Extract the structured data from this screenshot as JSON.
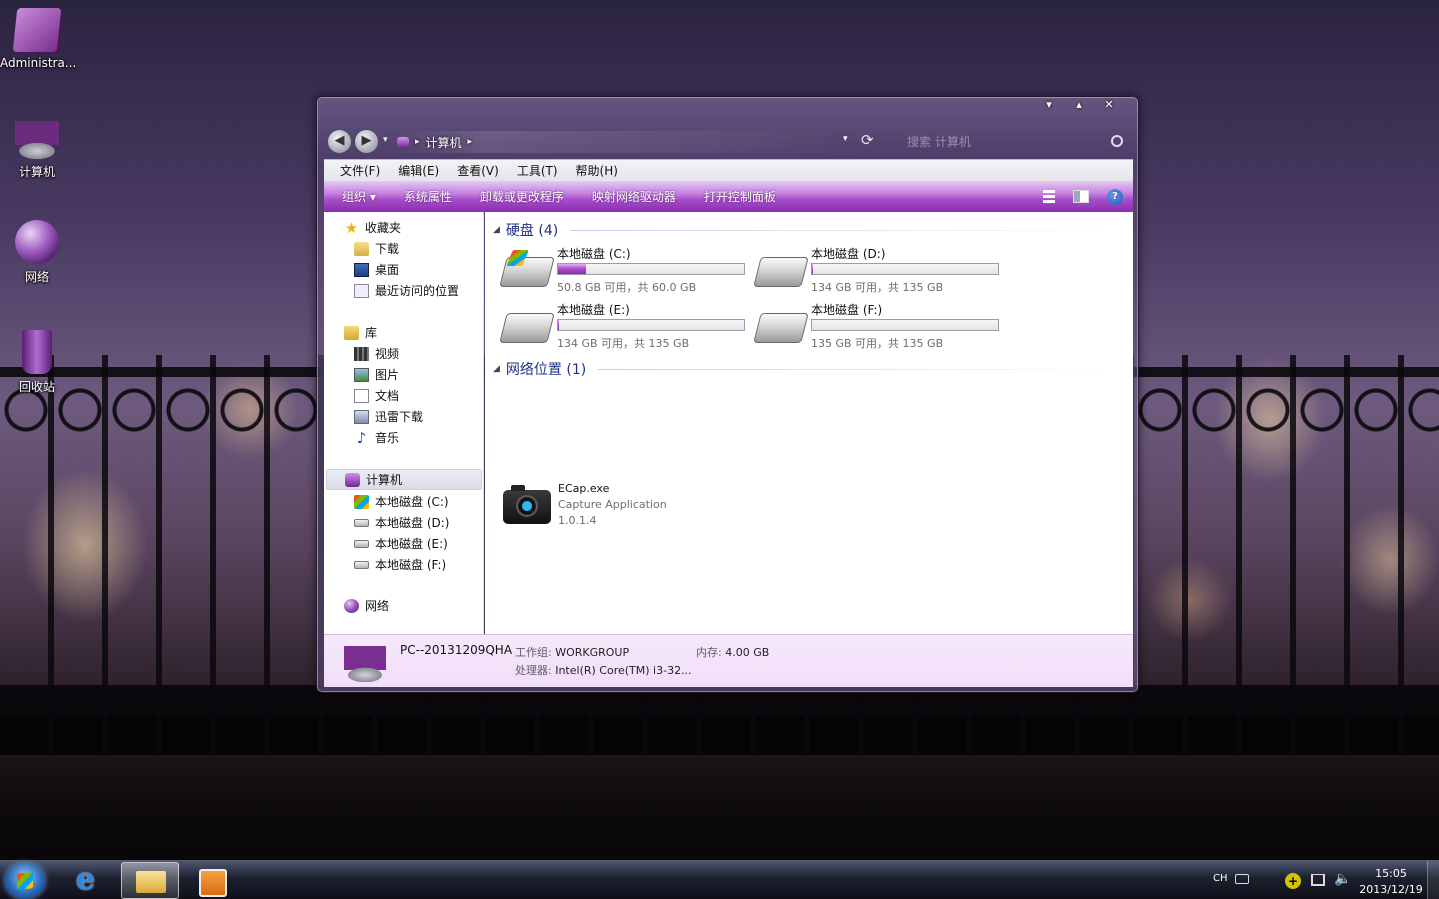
{
  "desktop": {
    "icons": [
      {
        "label": "Administra..."
      },
      {
        "label": "计算机"
      },
      {
        "label": "网络"
      },
      {
        "label": "回收站"
      }
    ]
  },
  "window": {
    "controls": {
      "minimize": "▾",
      "maximize": "▴",
      "close": "✕"
    },
    "address": {
      "back": "◀",
      "forward": "▶",
      "crumb": "计算机",
      "separator": "▸",
      "search_placeholder": "搜索 计算机"
    },
    "menu": [
      "文件(F)",
      "编辑(E)",
      "查看(V)",
      "工具(T)",
      "帮助(H)"
    ],
    "toolbar": [
      "组织 ▾",
      "系统属性",
      "卸载或更改程序",
      "映射网络驱动器",
      "打开控制面板"
    ],
    "nav": {
      "favorites": "收藏夹",
      "downloads": "下载",
      "desktop": "桌面",
      "recent": "最近访问的位置",
      "libraries": "库",
      "videos": "视频",
      "pictures": "图片",
      "documents": "文档",
      "xunlei": "迅雷下载",
      "music": "音乐",
      "computer": "计算机",
      "drive_c": "本地磁盘 (C:)",
      "drive_d": "本地磁盘 (D:)",
      "drive_e": "本地磁盘 (E:)",
      "drive_f": "本地磁盘 (F:)",
      "network": "网络"
    },
    "content": {
      "hdd_group": "硬盘 (4)",
      "drives": [
        {
          "name": "本地磁盘 (C:)",
          "free": "50.8 GB 可用，共 60.0 GB",
          "used_fraction": 0.153
        },
        {
          "name": "本地磁盘 (D:)",
          "free": "134 GB 可用，共 135 GB",
          "used_fraction": 0.007
        },
        {
          "name": "本地磁盘 (E:)",
          "free": "134 GB 可用，共 135 GB",
          "used_fraction": 0.007
        },
        {
          "name": "本地磁盘 (F:)",
          "free": "135 GB 可用，共 135 GB",
          "used_fraction": 0.0
        }
      ],
      "net_group": "网络位置 (1)",
      "net_item": {
        "name": "ECap.exe",
        "desc": "Capture Application",
        "version": "1.0.1.4"
      }
    },
    "details": {
      "pc_name": "PC--20131209QHA",
      "workgroup_label": "工作组:",
      "workgroup": "WORKGROUP",
      "memory_label": "内存:",
      "memory": "4.00 GB",
      "cpu_label": "处理器:",
      "cpu": "Intel(R) Core(TM) i3-32..."
    }
  },
  "taskbar": {
    "lang": "CH",
    "plus": "+",
    "volume": "🔈",
    "time": "15:05",
    "date": "2013/12/19"
  },
  "colors": {
    "toolbar_purple": "#a64ec9",
    "drive_fill": "#a64ac9",
    "group_header": "#1e3287",
    "details_bg": "#f6e8fb"
  }
}
